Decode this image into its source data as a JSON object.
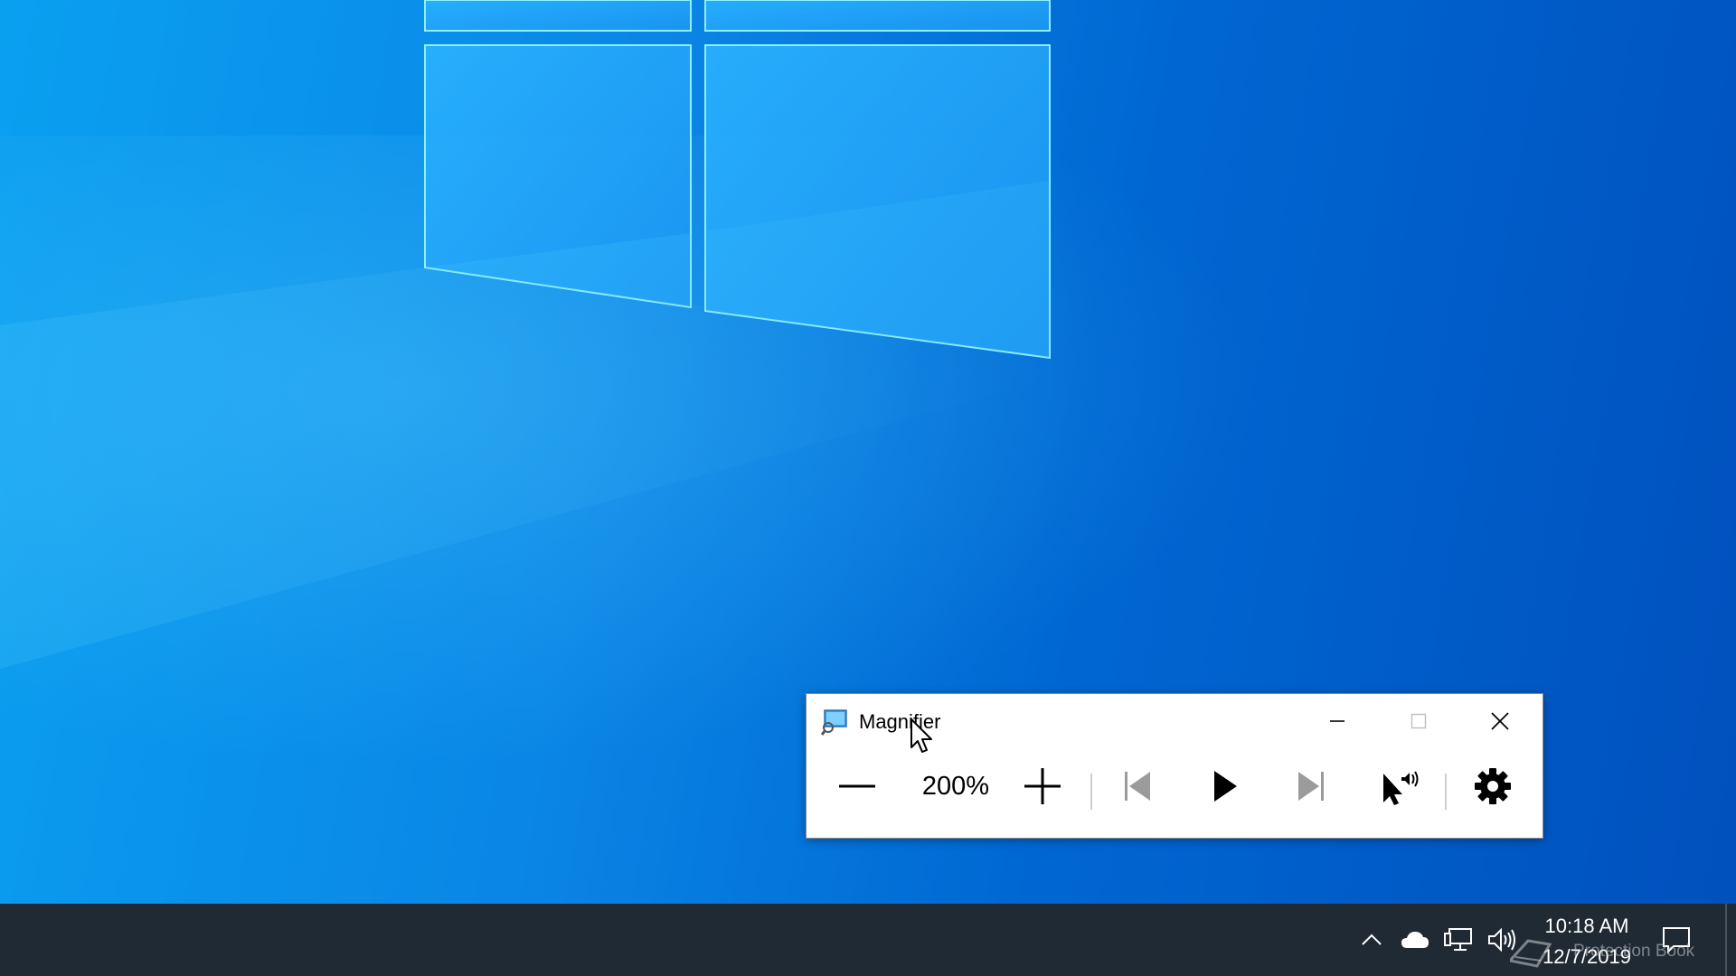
{
  "magnifier": {
    "title": "Magnifier",
    "zoom_level": "200%",
    "controls": {
      "zoom_out": "Zoom out",
      "zoom_in": "Zoom in",
      "previous": "Previous",
      "play": "Read",
      "next": "Next",
      "read_from_here": "Read from here",
      "settings": "Settings"
    },
    "window_controls": {
      "minimize": "Minimize",
      "maximize": "Maximize",
      "close": "Close"
    }
  },
  "taskbar": {
    "time": "10:18 AM",
    "date": "12/7/2019",
    "tray_icons": [
      "chevron-up-icon",
      "onedrive-icon",
      "network-icon",
      "volume-icon",
      "notification-center-icon"
    ],
    "colors": {
      "background": "#1f2a35",
      "text": "#ffffff"
    }
  },
  "desktop": {
    "accent_colors": [
      "#0aa0f0",
      "#0067d2",
      "#1e9df5"
    ]
  },
  "watermark": {
    "text": "Protection Book"
  }
}
